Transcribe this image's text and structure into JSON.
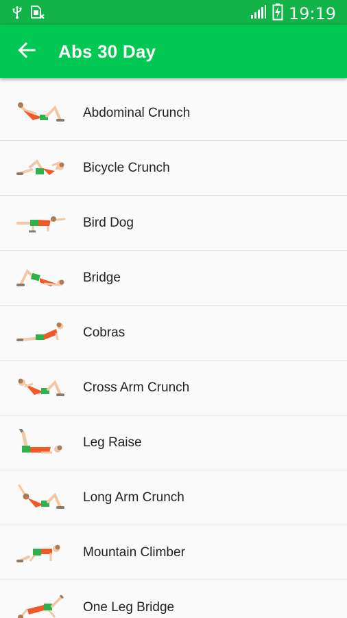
{
  "status_bar": {
    "time": "19:19",
    "icons": [
      "usb-icon",
      "sim-card-icon",
      "signal-icon",
      "battery-charging-icon"
    ]
  },
  "app_bar": {
    "title": "Abs 30 Day",
    "back_icon": "arrow-back-icon"
  },
  "exercises": [
    {
      "label": "Abdominal Crunch"
    },
    {
      "label": "Bicycle Crunch"
    },
    {
      "label": "Bird Dog"
    },
    {
      "label": "Bridge"
    },
    {
      "label": "Cobras"
    },
    {
      "label": "Cross Arm Crunch"
    },
    {
      "label": "Leg Raise"
    },
    {
      "label": "Long Arm Crunch"
    },
    {
      "label": "Mountain Climber"
    },
    {
      "label": "One Leg Bridge"
    }
  ],
  "colors": {
    "status_bar": "#12b348",
    "app_bar": "#00c853",
    "shirt": "#f05a28",
    "shorts": "#2fb24b",
    "skin": "#f2c7a5"
  }
}
